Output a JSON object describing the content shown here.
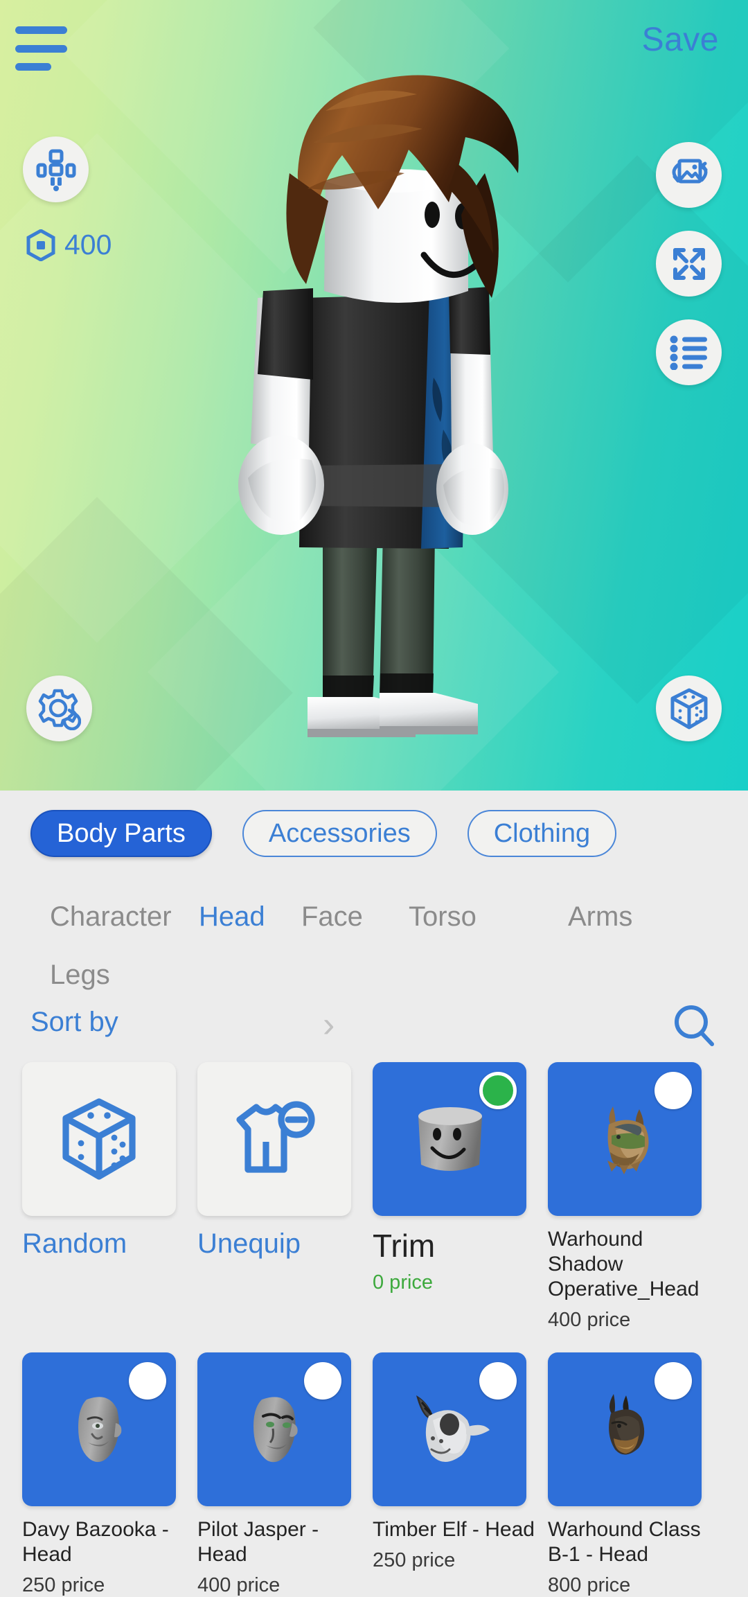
{
  "header": {
    "menu_icon": "hamburger-menu-icon",
    "save_label": "Save"
  },
  "viewport": {
    "robux_amount": "400",
    "robux_icon": "robux-hexagon-icon",
    "body_scale_icon": "avatar-body-scale-icon",
    "photo_icon": "photo-rotate-icon",
    "expand_icon": "expand-arrows-icon",
    "list_icon": "bulleted-list-icon",
    "settings_icon": "gear-refresh-icon",
    "dice_icon": "dice-cube-icon",
    "background_gradient_start": "#d8efa0",
    "background_gradient_end": "#18cfc8"
  },
  "categories": [
    {
      "label": "Body Parts",
      "active": true
    },
    {
      "label": "Accessories",
      "active": false
    },
    {
      "label": "Clothing",
      "active": false
    }
  ],
  "subcategories": [
    {
      "label": "Character",
      "active": false
    },
    {
      "label": "Head",
      "active": true
    },
    {
      "label": "Face",
      "active": false
    },
    {
      "label": "Torso",
      "active": false
    },
    {
      "label": "Arms",
      "active": false
    },
    {
      "label": "Legs",
      "active": false
    }
  ],
  "toolbar": {
    "sort_label": "Sort by",
    "sort_chevron": "chevron-right-icon",
    "search_icon": "search-icon"
  },
  "grid": {
    "actions": [
      {
        "label": "Random",
        "icon": "dice-cube-icon"
      },
      {
        "label": "Unequip",
        "icon": "outfit-minus-icon"
      }
    ],
    "items": [
      {
        "name": "Trim",
        "price": "0 price",
        "free": true,
        "equipped": true,
        "thumb": "gray-smiley-head"
      },
      {
        "name": "Warhound Shadow Operative_Head",
        "price": "400 price",
        "free": false,
        "equipped": false,
        "thumb": "warhound-shadow-head"
      },
      {
        "name": "Davy Bazooka - Head",
        "price": "250 price",
        "free": false,
        "equipped": false,
        "thumb": "davy-bazooka-head"
      },
      {
        "name": "Pilot Jasper - Head",
        "price": "400 price",
        "free": false,
        "equipped": false,
        "thumb": "pilot-jasper-head"
      },
      {
        "name": "Timber Elf - Head",
        "price": "250 price",
        "free": false,
        "equipped": false,
        "thumb": "timber-elf-head"
      },
      {
        "name": "Warhound Class B-1 - Head",
        "price": "800 price",
        "free": false,
        "equipped": false,
        "thumb": "warhound-b1-head"
      }
    ]
  },
  "colors": {
    "accent_blue": "#3b7fd4",
    "tab_active_blue": "#2563d6",
    "item_tile_blue": "#2e6fd9",
    "free_green": "#3da93d",
    "equipped_green": "#2bb34a",
    "panel_gray": "#ececec"
  }
}
